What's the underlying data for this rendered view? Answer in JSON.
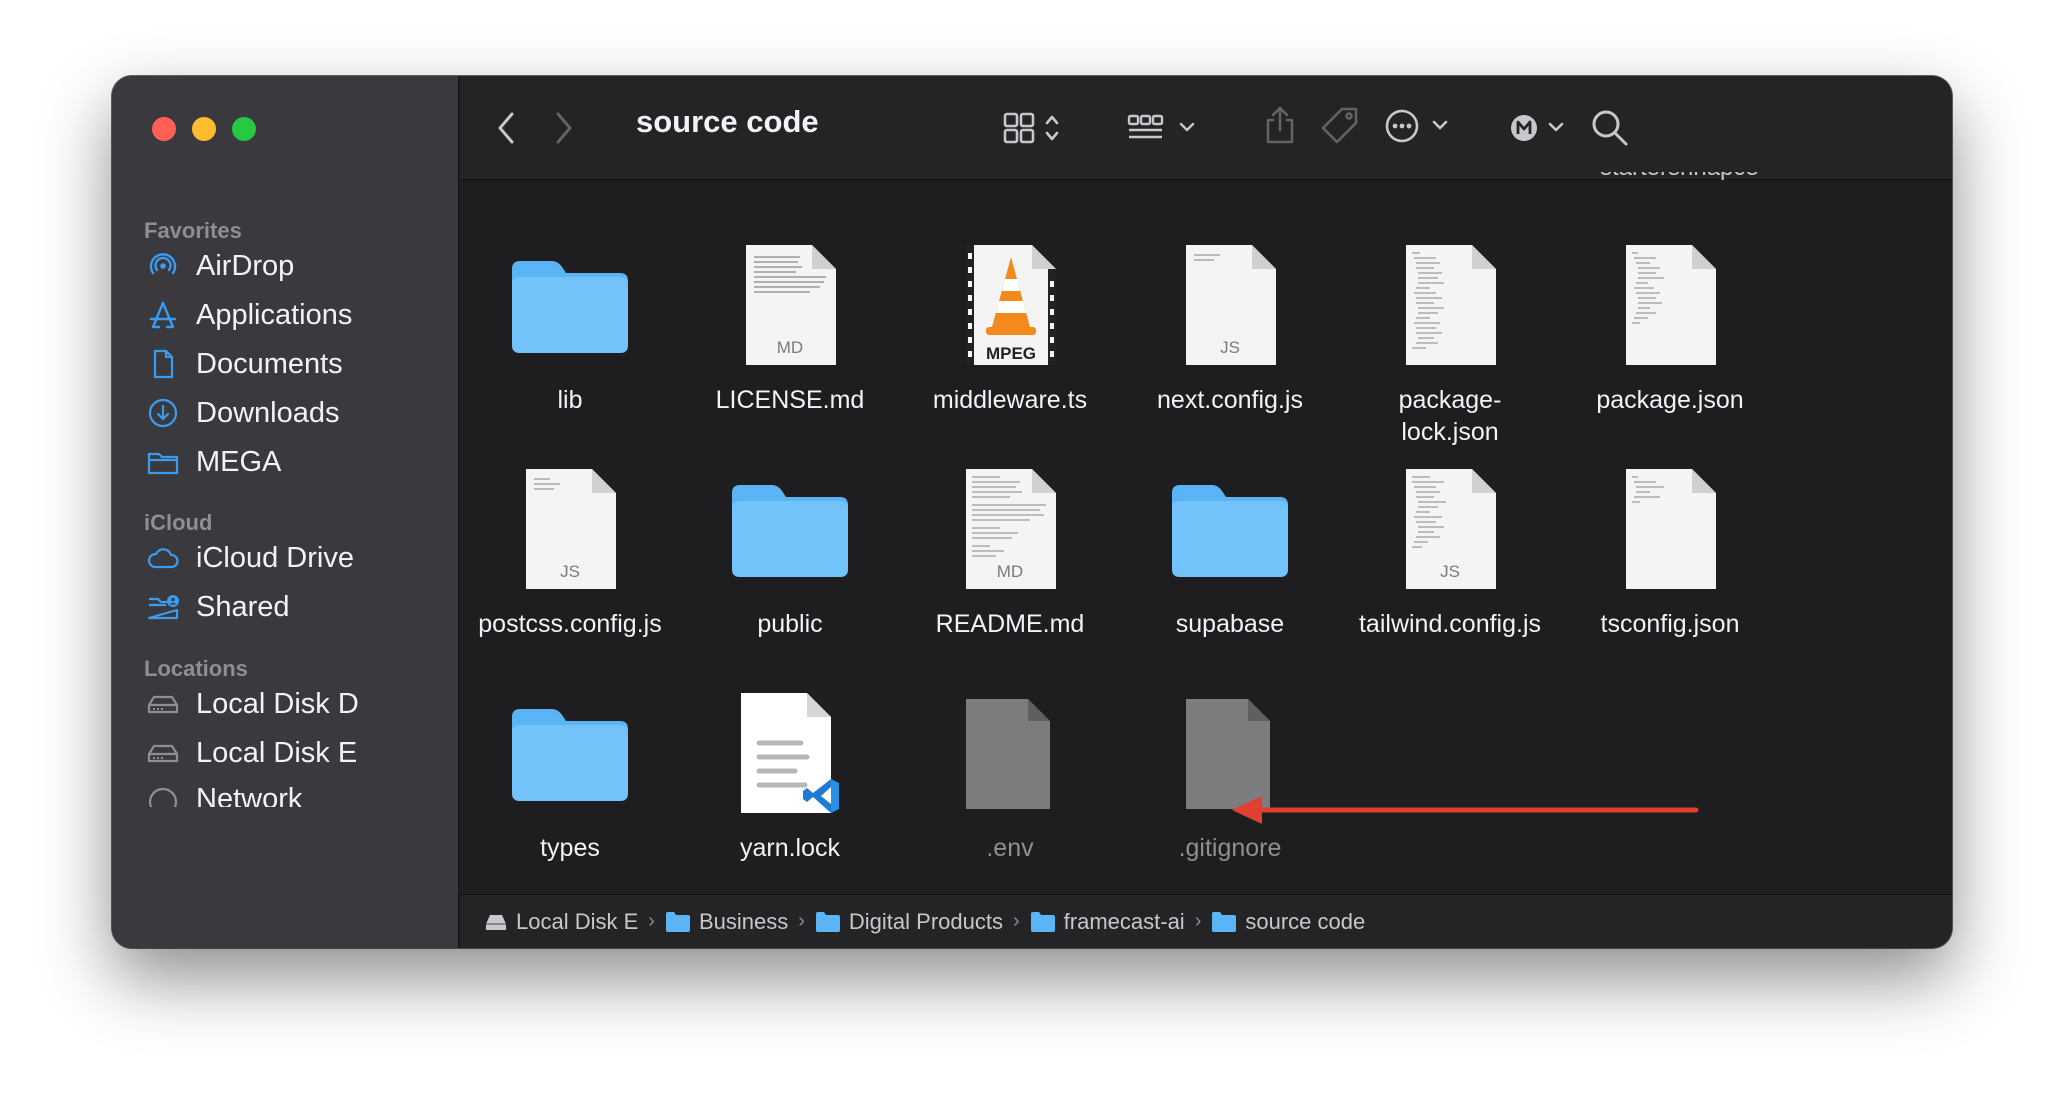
{
  "window": {
    "title": "source code"
  },
  "sidebar": {
    "sections": [
      {
        "label": "Favorites",
        "items": [
          {
            "label": "AirDrop",
            "icon": "airdrop-icon"
          },
          {
            "label": "Applications",
            "icon": "applications-icon"
          },
          {
            "label": "Documents",
            "icon": "document-icon"
          },
          {
            "label": "Downloads",
            "icon": "download-icon"
          },
          {
            "label": "MEGA",
            "icon": "folder-icon"
          }
        ]
      },
      {
        "label": "iCloud",
        "items": [
          {
            "label": "iCloud Drive",
            "icon": "cloud-icon"
          },
          {
            "label": "Shared",
            "icon": "shared-folder-icon"
          }
        ]
      },
      {
        "label": "Locations",
        "items": [
          {
            "label": "Local Disk D",
            "icon": "disk-icon"
          },
          {
            "label": "Local Disk E",
            "icon": "disk-icon"
          },
          {
            "label": "Network",
            "icon": "network-icon"
          }
        ]
      }
    ]
  },
  "toolbar": {
    "back": "chevron-left-icon",
    "forward": "chevron-right-icon",
    "view_mode": "icon-grid-view-icon",
    "group": "group-by-icon",
    "share": "share-icon",
    "tag": "tag-icon",
    "more": "ellipsis-circle-icon",
    "account": "mega-account-icon",
    "search": "search-icon",
    "clipped_text": "startershnapce"
  },
  "files": [
    {
      "name": "lib",
      "type": "folder"
    },
    {
      "name": "LICENSE.md",
      "type": "doc",
      "badge": "MD"
    },
    {
      "name": "middleware.ts",
      "type": "mpeg",
      "badge": "MPEG"
    },
    {
      "name": "next.config.js",
      "type": "doc",
      "badge": "JS"
    },
    {
      "name": "package-\nlock.json",
      "type": "doc",
      "badge": ""
    },
    {
      "name": "package.json",
      "type": "doc",
      "badge": ""
    },
    {
      "name": "postcss.config.js",
      "type": "doc",
      "badge": "JS"
    },
    {
      "name": "public",
      "type": "folder"
    },
    {
      "name": "README.md",
      "type": "doc",
      "badge": "MD"
    },
    {
      "name": "supabase",
      "type": "folder"
    },
    {
      "name": "tailwind.config.js",
      "type": "doc",
      "badge": "JS"
    },
    {
      "name": "tsconfig.json",
      "type": "doc",
      "badge": ""
    },
    {
      "name": "types",
      "type": "folder"
    },
    {
      "name": "yarn.lock",
      "type": "vscode"
    },
    {
      "name": ".env",
      "type": "hidden"
    },
    {
      "name": ".gitignore",
      "type": "hidden"
    }
  ],
  "annotation": {
    "arrow_color": "#e0402f"
  },
  "pathbar": {
    "crumbs": [
      {
        "label": "Local Disk E",
        "icon": "disk-icon"
      },
      {
        "label": "Business",
        "icon": "folder-icon"
      },
      {
        "label": "Digital Products",
        "icon": "folder-icon"
      },
      {
        "label": "framecast-ai",
        "icon": "folder-icon"
      },
      {
        "label": "source code",
        "icon": "folder-icon"
      }
    ]
  },
  "colors": {
    "accent": "#3b9bf0",
    "folder": "#5ab4f5"
  }
}
